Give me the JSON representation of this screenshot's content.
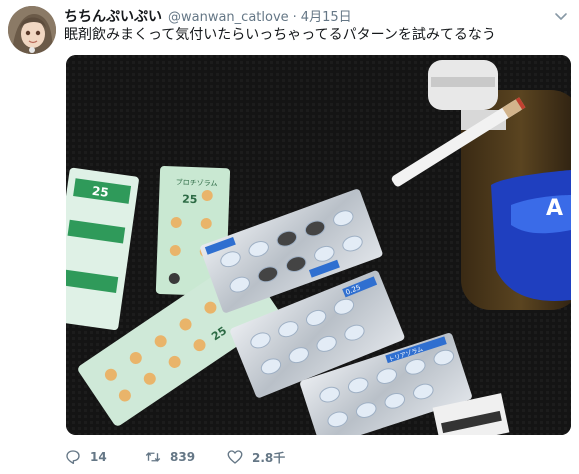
{
  "tweet": {
    "display_name": "ちちんぷいぷい",
    "handle": "@wanwan_catlove",
    "separator": "·",
    "date": "4月15日",
    "text": "眠剤飲みまくって気付いたらいっちゃってるパターンを試みてるなう"
  },
  "photo": {
    "package_text": {
      "green_strip_label": "ブロチゾラム",
      "green_strip_dose": "25",
      "blue_strip_label": "トリアゾラム",
      "blue_strip_dose": "0.25",
      "bottle_text": "A"
    }
  },
  "actions": {
    "reply_count": "14",
    "retweet_count": "839",
    "like_count": "2.8千"
  },
  "icons": {
    "caret": "chevron-down-icon",
    "reply": "reply-icon",
    "retweet": "retweet-icon",
    "like": "heart-icon"
  },
  "colors": {
    "text_primary": "#14171a",
    "text_secondary": "#657786"
  }
}
